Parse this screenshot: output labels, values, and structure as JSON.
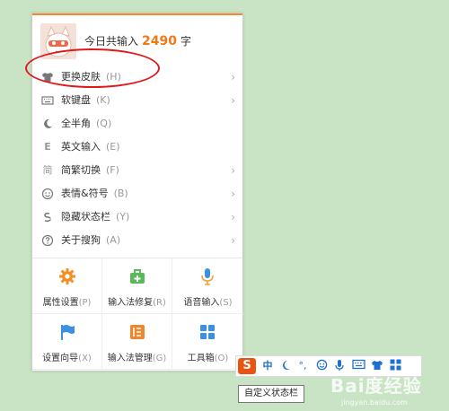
{
  "header": {
    "prefix": "今日共输入",
    "count": "2490",
    "suffix": "字"
  },
  "items": [
    {
      "label": "更换皮肤",
      "key": "(H)",
      "icon": "shirt-icon"
    },
    {
      "label": "软键盘",
      "key": "(K)",
      "icon": "keyboard-icon"
    },
    {
      "label": "全半角",
      "key": "(Q)",
      "icon": "moon-icon"
    },
    {
      "label": "英文输入",
      "key": "(E)",
      "icon": "english-icon"
    },
    {
      "label": "简繁切换",
      "key": "(F)",
      "icon": "simplified-traditional-icon"
    },
    {
      "label": "表情&符号",
      "key": "(B)",
      "icon": "smiley-icon"
    },
    {
      "label": "隐藏状态栏",
      "key": "(Y)",
      "icon": "hide-statusbar-icon"
    },
    {
      "label": "关于搜狗",
      "key": "(A)",
      "icon": "help-icon"
    }
  ],
  "tools": [
    {
      "label": "属性设置",
      "key": "(P)",
      "icon": "gear-icon"
    },
    {
      "label": "输入法修复",
      "key": "(R)",
      "icon": "repair-kit-icon"
    },
    {
      "label": "语音输入",
      "key": "(S)",
      "icon": "microphone-icon"
    },
    {
      "label": "设置向导",
      "key": "(X)",
      "icon": "flag-icon"
    },
    {
      "label": "输入法管理",
      "key": "(G)",
      "icon": "manage-icon"
    },
    {
      "label": "工具箱",
      "key": "(O)",
      "icon": "toolbox-icon"
    }
  ],
  "statusbar": {
    "logo": "S",
    "chinese_mode": "中",
    "punct": "°,",
    "icons": [
      "sogou-logo-icon",
      "chinese-mode-icon",
      "moon-icon",
      "punctuation-icon",
      "smiley-icon",
      "microphone-icon",
      "keyboard-icon",
      "shirt-icon",
      "grid-icon"
    ]
  },
  "tooltip": "自定义状态栏",
  "watermark": {
    "main": "Bai度经验",
    "sub": "jingyan.baidu.com"
  },
  "colors": {
    "accent": "#f07a16",
    "highlight_ring": "#e0191c",
    "status_blue": "#1f6fd0",
    "background": "#c9e4c4"
  }
}
